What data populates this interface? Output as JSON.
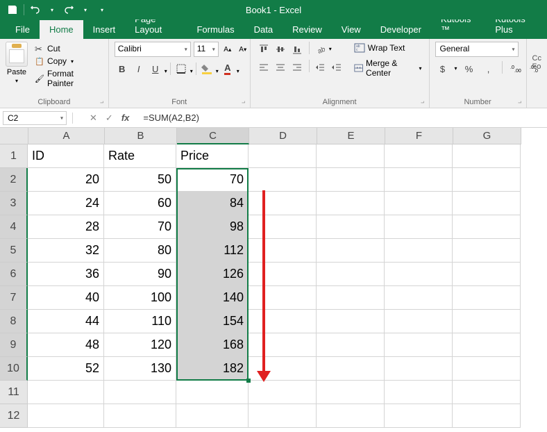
{
  "titlebar": {
    "title": "Book1 - Excel"
  },
  "tabs": {
    "file": "File",
    "home": "Home",
    "insert": "Insert",
    "page_layout": "Page Layout",
    "formulas": "Formulas",
    "data": "Data",
    "review": "Review",
    "view": "View",
    "developer": "Developer",
    "kutools": "Kutools ™",
    "kutools_plus": "Kutools Plus"
  },
  "ribbon": {
    "clipboard": {
      "paste": "Paste",
      "cut": "Cut",
      "copy": "Copy",
      "format_painter": "Format Painter",
      "label": "Clipboard"
    },
    "font": {
      "name": "Calibri",
      "size": "11",
      "label": "Font"
    },
    "alignment": {
      "wrap_text": "Wrap Text",
      "merge_center": "Merge & Center",
      "label": "Alignment"
    },
    "number": {
      "format": "General",
      "label": "Number"
    },
    "cond": {
      "label": "Cc\nFo"
    }
  },
  "formula_bar": {
    "name_box": "C2",
    "formula": "=SUM(A2,B2)"
  },
  "columns": [
    "A",
    "B",
    "C",
    "D",
    "E",
    "F",
    "G"
  ],
  "rows": [
    1,
    2,
    3,
    4,
    5,
    6,
    7,
    8,
    9,
    10,
    11,
    12
  ],
  "headers": {
    "A": "ID",
    "B": "Rate",
    "C": "Price"
  },
  "data": [
    {
      "id": 20,
      "rate": 50,
      "price": 70
    },
    {
      "id": 24,
      "rate": 60,
      "price": 84
    },
    {
      "id": 28,
      "rate": 70,
      "price": 98
    },
    {
      "id": 32,
      "rate": 80,
      "price": 112
    },
    {
      "id": 36,
      "rate": 90,
      "price": 126
    },
    {
      "id": 40,
      "rate": 100,
      "price": 140
    },
    {
      "id": 44,
      "rate": 110,
      "price": 154
    },
    {
      "id": 48,
      "rate": 120,
      "price": 168
    },
    {
      "id": 52,
      "rate": 130,
      "price": 182
    }
  ]
}
